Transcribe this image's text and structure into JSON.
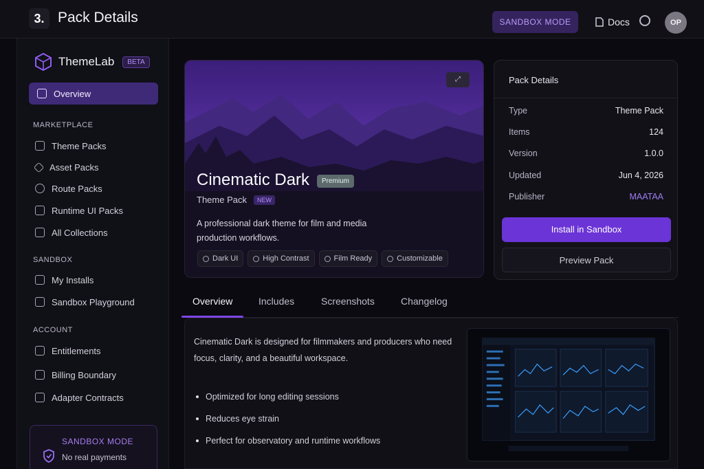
{
  "header": {
    "step": "3.",
    "title": "Pack Details",
    "sandbox_mode": "SANDBOX MODE",
    "docs": "Docs",
    "avatar_initials": "OP"
  },
  "sidebar": {
    "brand": "ThemeLab",
    "beta": "BETA",
    "active_item": "Overview",
    "sections": {
      "marketplace": "MARKETPLACE",
      "sandbox": "SANDBOX",
      "account": "ACCOUNT"
    },
    "marketplace_items": [
      "Theme Packs",
      "Asset Packs",
      "Route Packs",
      "Runtime UI Packs",
      "All Collections"
    ],
    "sandbox_items": [
      "My Installs",
      "Sandbox Playground"
    ],
    "account_items": [
      "Entitlements",
      "Billing Boundary",
      "Adapter Contracts"
    ],
    "sandbox_card": {
      "title": "SANDBOX MODE",
      "text": "No real payments"
    }
  },
  "hero": {
    "title": "Cinematic Dark",
    "badge": "Premium",
    "subtitle": "Theme Pack",
    "new_chip": "NEW",
    "description": "A professional dark theme for film and media production workflows.",
    "tags": [
      "Dark UI",
      "High Contrast",
      "Film Ready",
      "Customizable"
    ],
    "expand_label": "⤢"
  },
  "details": {
    "title": "Pack Details",
    "rows": [
      {
        "label": "Type",
        "value": "Theme Pack"
      },
      {
        "label": "Items",
        "value": "124"
      },
      {
        "label": "Version",
        "value": "1.0.0"
      },
      {
        "label": "Updated",
        "value": "Jun 4, 2026"
      },
      {
        "label": "Publisher",
        "value": "MAATAA"
      }
    ],
    "install": "Install in Sandbox",
    "preview": "Preview Pack"
  },
  "tabs": [
    "Overview",
    "Includes",
    "Screenshots",
    "Changelog"
  ],
  "overview": {
    "text": "Cinematic Dark is designed for filmmakers and producers who need focus, clarity, and a beautiful workspace.",
    "bullets": [
      "Optimized for long editing sessions",
      "Reduces eye strain",
      "Perfect for observatory and runtime workflows"
    ]
  },
  "colors": {
    "accent": "#6b34d6",
    "accent_light": "#9e7bf0",
    "background": "#0b0a10"
  }
}
